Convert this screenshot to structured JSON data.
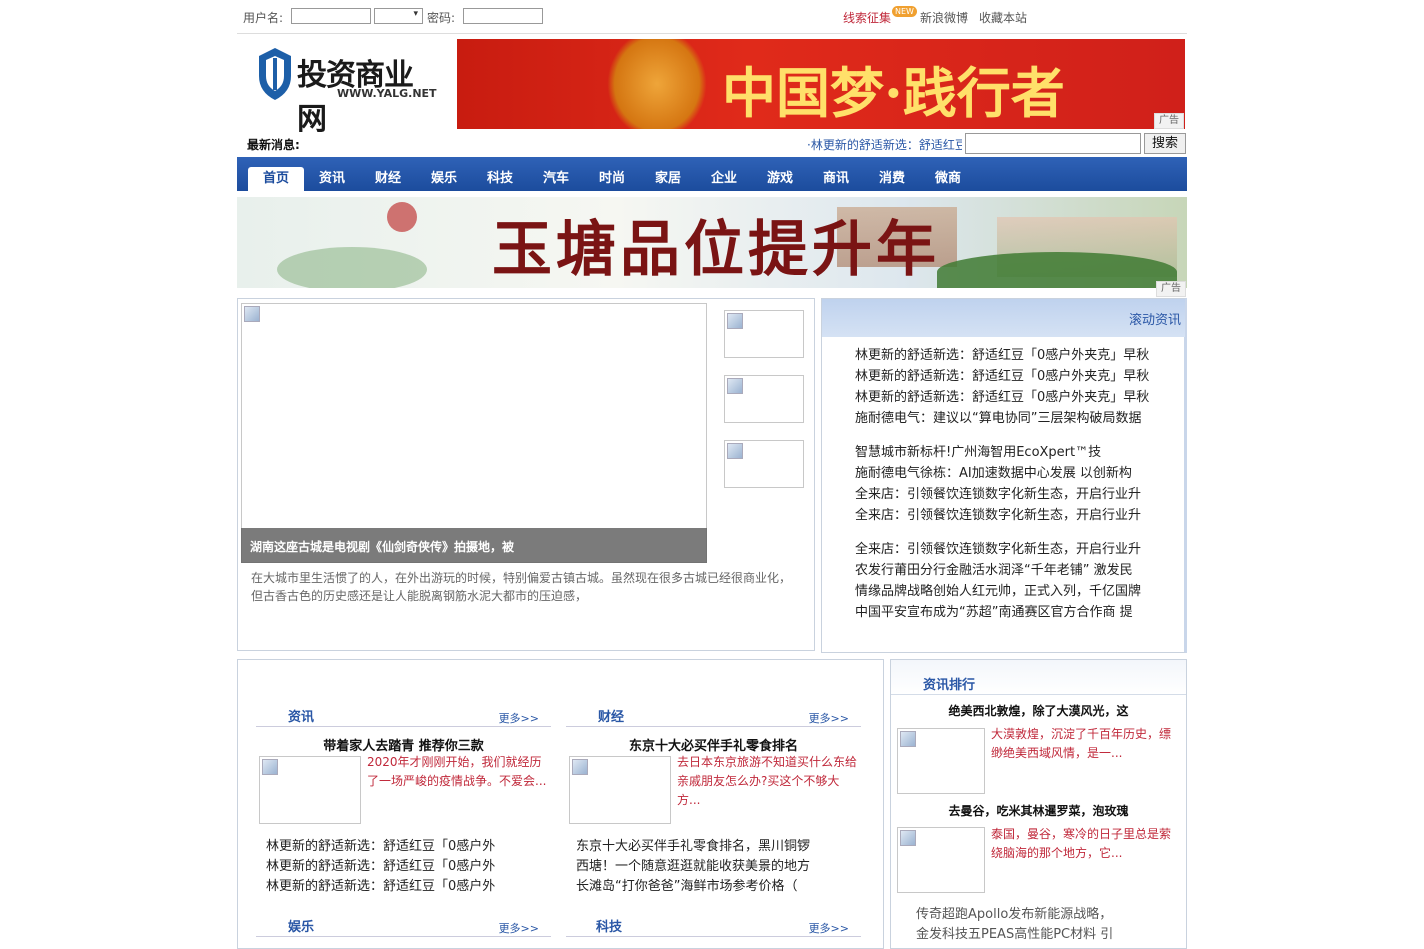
{
  "top_bar": {
    "username_label": "用户名:",
    "password_label": "密码:",
    "clue_link": "线索征集",
    "clue_badge": "NEW",
    "weibo_link": "新浪微博",
    "bookmark_link": "收藏本站"
  },
  "logo": {
    "main": "投资商业网",
    "url": "WWW.YALG.NET"
  },
  "banner_top": {
    "text": "中国梦·践行者",
    "ad_label": "广告"
  },
  "latest": {
    "label": "最新消息:",
    "ticker": "·林更新的舒适新选：舒适红豆",
    "search_button": "搜索"
  },
  "nav": [
    "首页",
    "资讯",
    "财经",
    "娱乐",
    "科技",
    "汽车",
    "时尚",
    "家居",
    "企业",
    "游戏",
    "商讯",
    "消费",
    "微商"
  ],
  "banner_mid": {
    "text": "玉塘品位提升年",
    "ad_label": "广告"
  },
  "featured": {
    "caption": "湖南这座古城是电视剧《仙剑奇侠传》拍摄地，被",
    "summary_line1": "在大城市里生活惯了的人，在外出游玩的时候，特别偏爱古镇古城。虽然现在很多古城已经很商业化，",
    "summary_line2": "但古香古色的历史感还是让人能脱离钢筋水泥大都市的压迫感，"
  },
  "scroll_news": {
    "title": "滚动资讯",
    "group1": [
      "林更新的舒适新选：舒适红豆「0感户外夹克」早秋",
      "林更新的舒适新选：舒适红豆「0感户外夹克」早秋",
      "林更新的舒适新选：舒适红豆「0感户外夹克」早秋",
      "施耐德电气：建议以“算电协同”三层架构破局数据"
    ],
    "group2": [
      "智慧城市新标杆!广州海智用EcoXpert™技",
      "施耐德电气徐栋：AI加速数据中心发展 以创新构",
      "全来店：引领餐饮连锁数字化新生态，开启行业升",
      "全来店：引领餐饮连锁数字化新生态，开启行业升"
    ],
    "group3": [
      "全来店：引领餐饮连锁数字化新生态，开启行业升",
      "农发行莆田分行金融活水润泽“千年老铺” 激发民",
      "情缘品牌战略创始人红元帅，正式入列，千亿国牌",
      "中国平安宣布成为“苏超”南通赛区官方合作商 提"
    ]
  },
  "sections": {
    "more": "更多>>",
    "zixun": {
      "title": "资讯",
      "headline": "带着家人去踏青 推荐你三款",
      "summary": [
        "2020年才刚刚开始，我们就经历",
        "了一场严峻的疫情战争。不爱会..."
      ],
      "list": [
        "林更新的舒适新选：舒适红豆「0感户外",
        "林更新的舒适新选：舒适红豆「0感户外",
        "林更新的舒适新选：舒适红豆「0感户外"
      ]
    },
    "caijing": {
      "title": "财经",
      "headline": "东京十大必买伴手礼零食排名",
      "summary": [
        "去日本东京旅游不知道买什么东给",
        "亲戚朋友怎么办?买这个不够大",
        "方..."
      ],
      "list": [
        "东京十大必买伴手礼零食排名，黑川铜锣",
        "西塘！一个随意逛逛就能收获美景的地方",
        "长滩岛“打你爸爸”海鲜市场参考价格（"
      ]
    },
    "yule": {
      "title": "娱乐"
    },
    "keji": {
      "title": "科技"
    }
  },
  "ranking": {
    "title": "资讯排行",
    "item1_title": "绝美西北敦煌，除了大漠风光，这",
    "item1_summary": [
      "大漠敦煌，沉淀了千百年历史，缥",
      "缈绝美西域风情，是一..."
    ],
    "item2_title": "去曼谷，吃米其林暹罗菜，泡玫瑰",
    "item2_summary": [
      "泰国，曼谷，寒冷的日子里总是萦",
      "绕脑海的那个地方，它..."
    ],
    "list": [
      "传奇超跑Apollo发布新能源战略，",
      "金发科技五PEAS高性能PC材料 引"
    ]
  }
}
